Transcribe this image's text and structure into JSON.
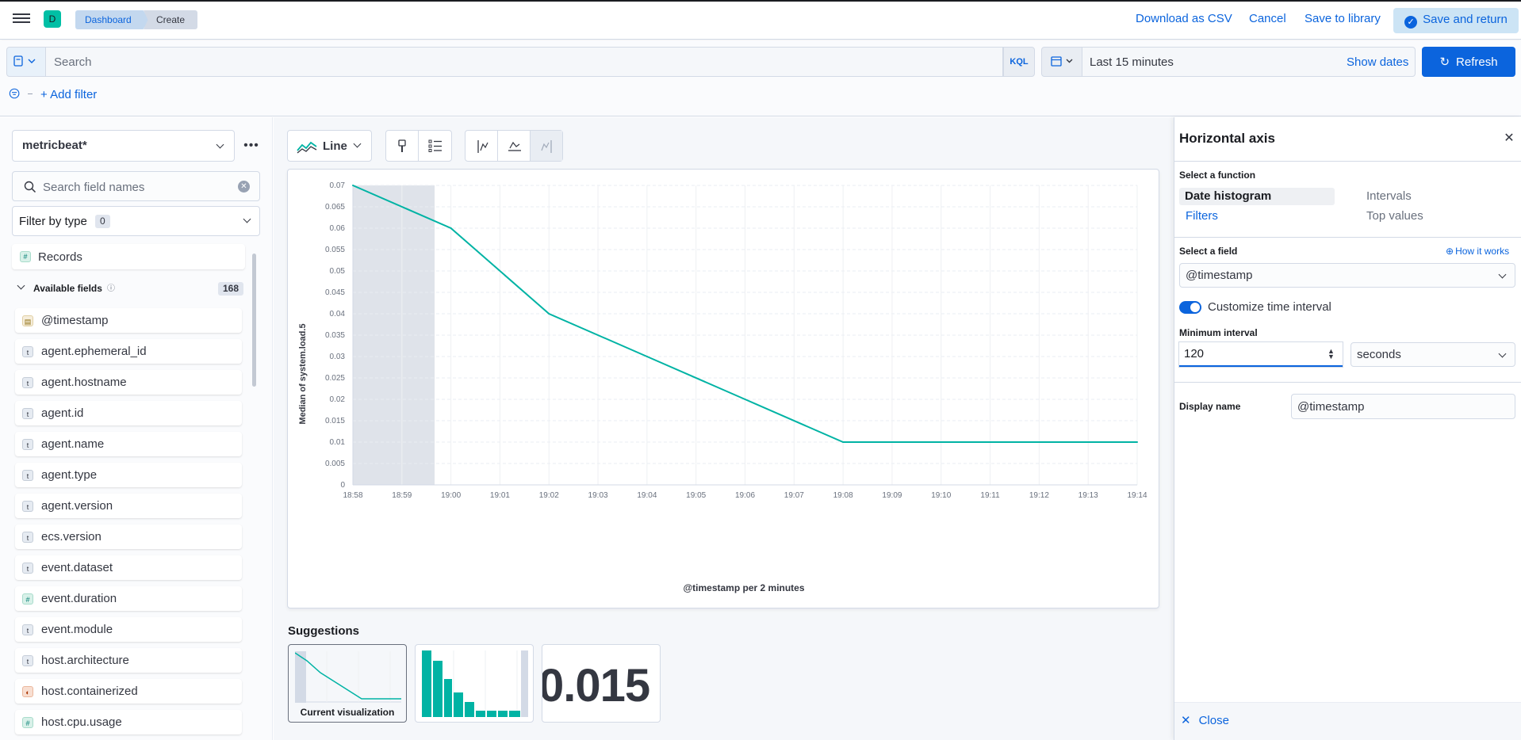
{
  "header": {
    "space_initial": "D",
    "breadcrumbs": [
      "Dashboard",
      "Create"
    ],
    "download_csv": "Download as CSV",
    "cancel": "Cancel",
    "save_to_library": "Save to library",
    "save_and_return": "Save and return"
  },
  "query": {
    "search_placeholder": "Search",
    "language": "KQL",
    "time_range": "Last 15 minutes",
    "show_dates": "Show dates",
    "refresh": "Refresh",
    "add_filter": "+ Add filter"
  },
  "sidebar": {
    "data_view": "metricbeat*",
    "field_search_placeholder": "Search field names",
    "filter_by_type": "Filter by type",
    "filter_count": "0",
    "records": "Records",
    "available_fields_label": "Available fields",
    "available_fields_count": "168",
    "fields": [
      {
        "name": "@timestamp",
        "type": "date"
      },
      {
        "name": "agent.ephemeral_id",
        "type": "string"
      },
      {
        "name": "agent.hostname",
        "type": "string"
      },
      {
        "name": "agent.id",
        "type": "string"
      },
      {
        "name": "agent.name",
        "type": "string"
      },
      {
        "name": "agent.type",
        "type": "string"
      },
      {
        "name": "agent.version",
        "type": "string"
      },
      {
        "name": "ecs.version",
        "type": "string"
      },
      {
        "name": "event.dataset",
        "type": "string"
      },
      {
        "name": "event.duration",
        "type": "number"
      },
      {
        "name": "event.module",
        "type": "string"
      },
      {
        "name": "host.architecture",
        "type": "string"
      },
      {
        "name": "host.containerized",
        "type": "boolean"
      },
      {
        "name": "host.cpu.usage",
        "type": "number"
      }
    ]
  },
  "workspace": {
    "chart_type_label": "Line",
    "suggestions_title": "Suggestions",
    "current_viz_label": "Current visualization",
    "metric_suggestion_value": "0.015"
  },
  "chart_data": {
    "type": "line",
    "x": [
      "18:58",
      "19:00",
      "19:02",
      "19:04",
      "19:06",
      "19:08",
      "19:10",
      "19:12",
      "19:14"
    ],
    "x_ticks": [
      "18:58",
      "18:59",
      "19:00",
      "19:01",
      "19:02",
      "19:03",
      "19:04",
      "19:05",
      "19:06",
      "19:07",
      "19:08",
      "19:09",
      "19:10",
      "19:11",
      "19:12",
      "19:13",
      "19:14"
    ],
    "series": [
      {
        "values": [
          0.07,
          0.06,
          0.04,
          0.03,
          0.02,
          0.01,
          0.01,
          0.01,
          0.01
        ]
      }
    ],
    "y_ticks": [
      "0",
      "0.005",
      "0.01",
      "0.015",
      "0.02",
      "0.025",
      "0.03",
      "0.035",
      "0.04",
      "0.045",
      "0.05",
      "0.055",
      "0.06",
      "0.065",
      "0.07"
    ],
    "ylim": [
      0,
      0.07
    ],
    "ylabel": "Median of system.load.5",
    "xlabel": "@timestamp per 2 minutes",
    "partial_bucket_end": "18:59:40",
    "color": "#00b3a4",
    "grid": true
  },
  "flyout": {
    "title": "Horizontal axis",
    "select_function_label": "Select a function",
    "functions": [
      "Date histogram",
      "Intervals",
      "Filters",
      "Top values"
    ],
    "selected_function": "Date histogram",
    "select_field_label": "Select a field",
    "how_it_works": "How it works",
    "field_value": "@timestamp",
    "customize_interval_label": "Customize time interval",
    "customize_interval_enabled": true,
    "min_interval_label": "Minimum interval",
    "min_interval_value": "120",
    "interval_unit": "seconds",
    "display_name_label": "Display name",
    "display_name_value": "@timestamp",
    "close": "Close"
  },
  "colors": {
    "primary": "#0b64dd",
    "accent_teal": "#00b3a4"
  }
}
